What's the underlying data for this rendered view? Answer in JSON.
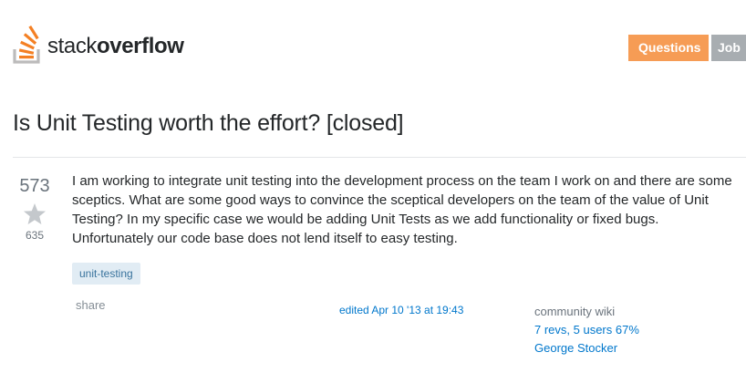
{
  "header": {
    "logo": {
      "text_light": "stack",
      "text_bold": "overflow"
    },
    "nav": {
      "questions_label": "Questions",
      "jobs_label": "Job"
    }
  },
  "question": {
    "title": "Is Unit Testing worth the effort? [closed]",
    "vote_count": "573",
    "favorite_count": "635",
    "body": "I am working to integrate unit testing into the development process on the team I work on and there are some sceptics. What are some good ways to convince the sceptical developers on the team of the value of Unit Testing? In my specific case we would be adding Unit Tests as we add functionality or fixed bugs. Unfortunately our code base does not lend itself to easy testing.",
    "tags": [
      "unit-testing"
    ],
    "share_label": "share",
    "edited_label": "edited Apr 10 '13 at 19:43",
    "community": {
      "label": "community wiki",
      "revs": "7 revs, 5 users 67%",
      "user": "George Stocker"
    }
  },
  "colors": {
    "brand_orange": "#f48024",
    "questions_button": "#f69c55",
    "jobs_button": "#a8adb1",
    "link_blue": "#0077cc",
    "tag_bg": "#e1ecf4",
    "tag_text": "#39739d"
  }
}
